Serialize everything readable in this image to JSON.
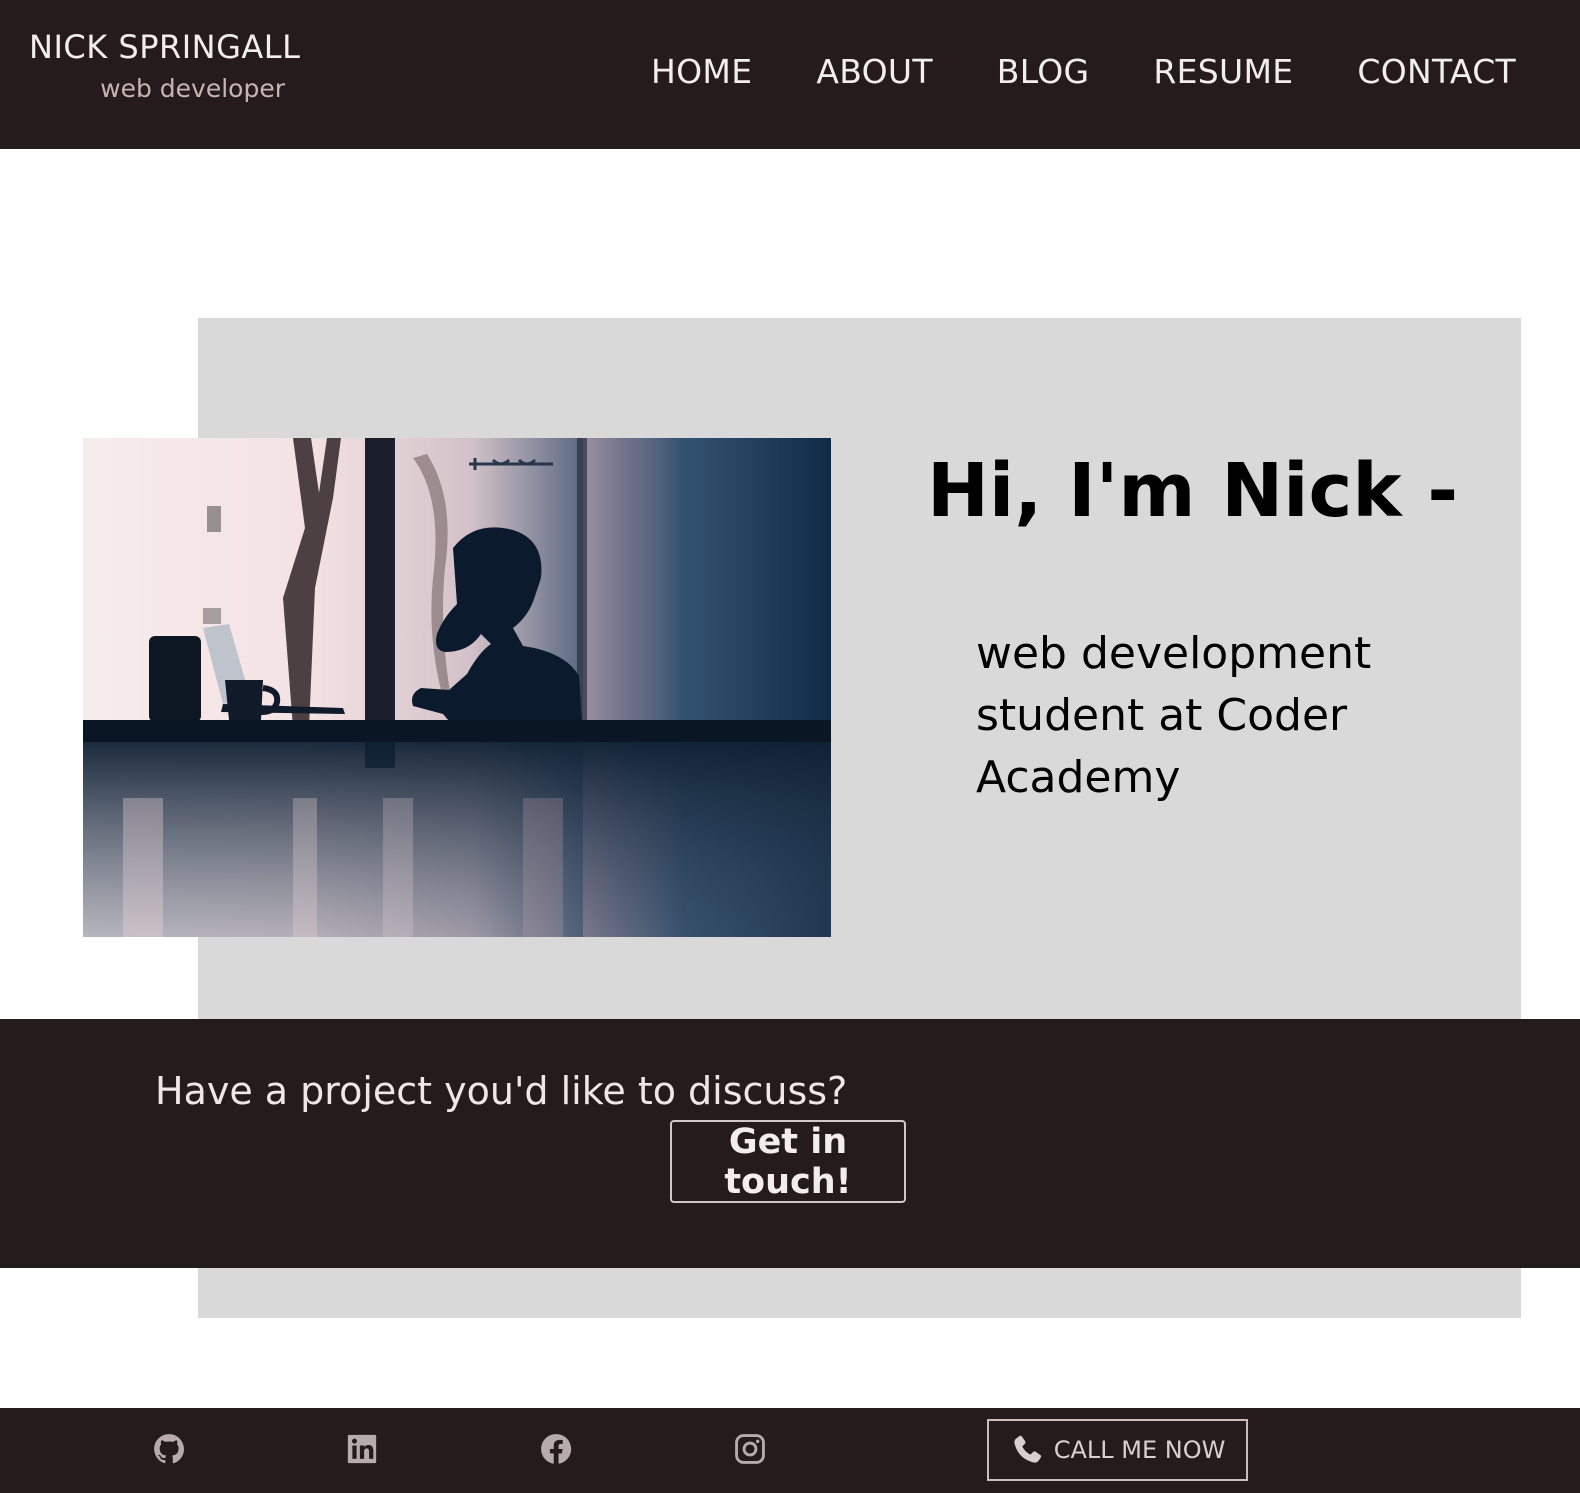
{
  "header": {
    "brand_name": "NICK SPRINGALL",
    "brand_tagline": "web developer",
    "nav": [
      "HOME",
      "ABOUT",
      "BLOG",
      "RESUME",
      "CONTACT"
    ]
  },
  "hero": {
    "heading": "Hi, I'm Nick -",
    "subheading": "web development student at Coder Academy",
    "photo_icon": "silhouette-at-laptop-photo"
  },
  "cta": {
    "prompt": "Have a project you'd like to discuss?",
    "button_label": "Get in touch!"
  },
  "footer": {
    "socials": [
      {
        "icon": "github-icon"
      },
      {
        "icon": "linkedin-icon"
      },
      {
        "icon": "facebook-icon"
      },
      {
        "icon": "instagram-icon"
      }
    ],
    "call_label": "CALL ME NOW",
    "call_icon": "phone-icon"
  },
  "colors": {
    "dark": "#251b1c",
    "panel": "#d9d9d9",
    "tagline": "#c9b3b2",
    "light_text": "#f3eeee"
  }
}
